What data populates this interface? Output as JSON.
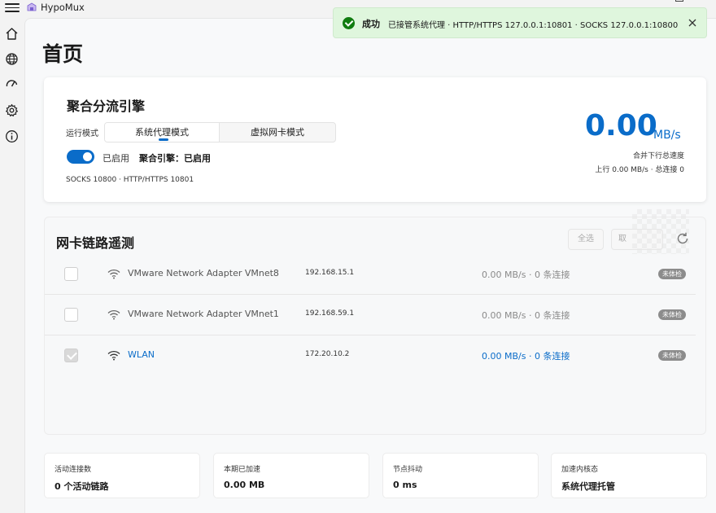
{
  "app": {
    "name": "HypoMux"
  },
  "nav": {
    "items": [
      {
        "icon": "home-icon"
      },
      {
        "icon": "globe-icon"
      },
      {
        "icon": "speedometer-icon"
      },
      {
        "icon": "gear-icon"
      },
      {
        "icon": "info-icon"
      }
    ]
  },
  "page": {
    "title": "首页"
  },
  "engine": {
    "title": "聚合分流引擎",
    "mode_label": "运行模式",
    "modes": [
      "系统代理模式",
      "虚拟网卡模式"
    ],
    "selected_mode": "系统代理模式",
    "toggle_on": true,
    "toggle_text": "已启用",
    "status_text": "聚合引擎：已启用",
    "ports": "SOCKS 10800 · HTTP/HTTPS 10801",
    "speed_value": "0.00",
    "speed_unit": "MB/s",
    "speed_caption": "合并下行总速度",
    "speed_sub": "上行 0.00 MB/s · 总连接 0"
  },
  "telemetry": {
    "title": "网卡链路遥测",
    "select_all": "全选",
    "second_button": "取",
    "adapters": [
      {
        "name": "VMware Network Adapter VMnet8",
        "ip": "192.168.15.1",
        "traffic": "0.00 MB/s · 0 条连接",
        "badge": "未体检",
        "checked": false
      },
      {
        "name": "VMware Network Adapter VMnet1",
        "ip": "192.168.59.1",
        "traffic": "0.00 MB/s · 0 条连接",
        "badge": "未体检",
        "checked": false
      },
      {
        "name": "WLAN",
        "ip": "172.20.10.2",
        "traffic": "0.00 MB/s · 0 条连接",
        "badge": "未体检",
        "checked": true
      }
    ]
  },
  "stats": [
    {
      "label": "活动连接数",
      "value": "0 个活动链路"
    },
    {
      "label": "本期已加速",
      "value": "0.00 MB"
    },
    {
      "label": "节点抖动",
      "value": "0 ms"
    },
    {
      "label": "加速内核态",
      "value": "系统代理托管"
    }
  ],
  "toast": {
    "title": "成功",
    "message": "已接管系统代理 · HTTP/HTTPS 127.0.0.1:10801 · SOCKS 127.0.0.1:10800"
  },
  "colors": {
    "accent": "#0a6cc9",
    "success": "#107c10",
    "toast_bg": "#dff6dd"
  }
}
